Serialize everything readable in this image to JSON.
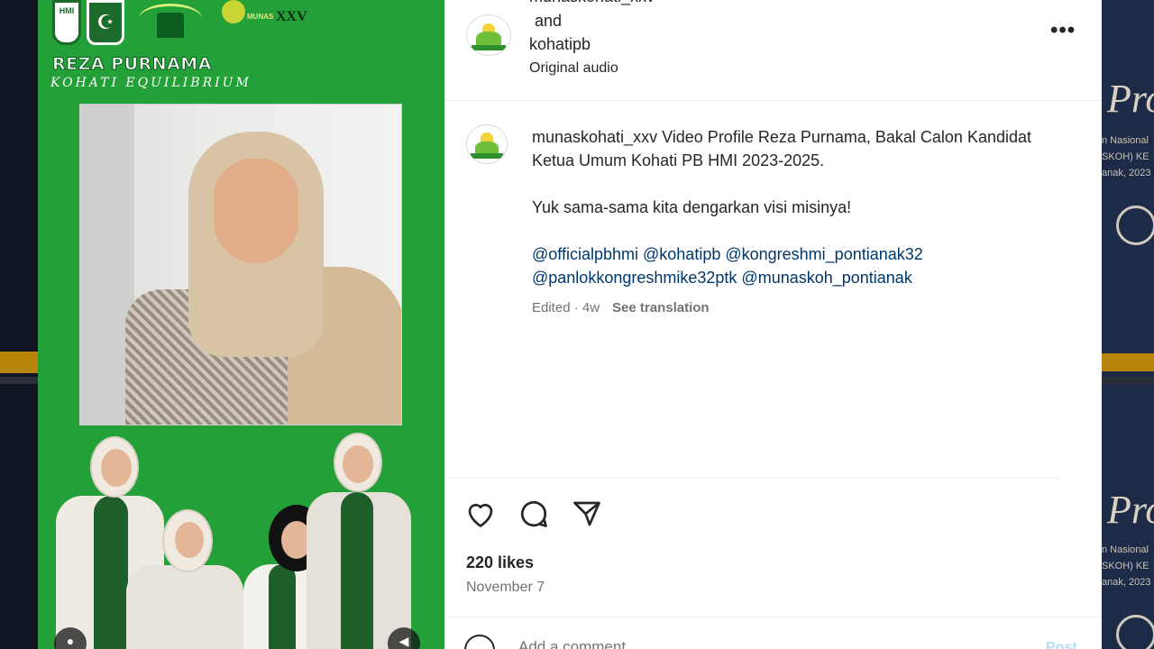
{
  "video": {
    "name_title": "REZA PURNAMA",
    "name_subtitle": "KOHATI EQUILIBRIUM",
    "logo_hmi_text": "HMI",
    "logo_munas_text": "MUNAS",
    "logo_xxv_text": "XXV"
  },
  "background": {
    "pro_text": "Pro",
    "lines": [
      "n Nasional",
      "SKOH) KE",
      "anak, 2023"
    ]
  },
  "header": {
    "user1": "munaskohati_xxv",
    "and": "and",
    "user2": "kohatipb",
    "audio": "Original audio"
  },
  "caption": {
    "username": "munaskohati_xxv",
    "text": "Video Profile Reza Purnama, Bakal Calon Kandidat Ketua Umum Kohati PB HMI 2023-2025.",
    "line2": "Yuk sama-sama kita dengarkan visi misinya!",
    "mentions": [
      "@officialpbhmi",
      "@kohatipb",
      "@kongreshmi_pontianak32",
      "@panlokkongreshmike32ptk",
      "@munaskoh_pontianak"
    ]
  },
  "meta": {
    "edited": "Edited · 4w",
    "translate": "See translation"
  },
  "stats": {
    "likes": "220 likes",
    "date": "November 7"
  },
  "comment": {
    "placeholder": "Add a comment…",
    "post": "Post"
  },
  "icons": {
    "like": "heart-icon",
    "comment": "speech-bubble-icon",
    "share": "paper-plane-icon",
    "more": "ellipsis-icon",
    "emoji": "smiley-icon"
  },
  "colors": {
    "video_green": "#23a038",
    "mention_blue": "#00376b",
    "post_button": "#b2dffc"
  }
}
